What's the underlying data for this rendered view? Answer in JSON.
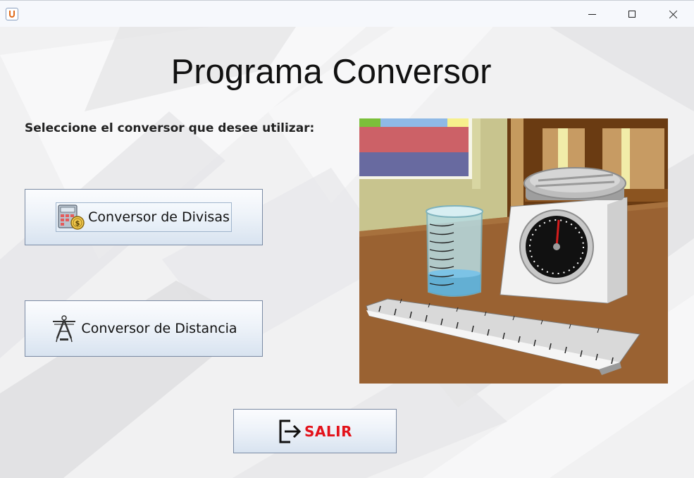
{
  "window": {
    "icon": "java-cup-icon",
    "controls": {
      "minimize_icon": "minimize-icon",
      "maximize_icon": "maximize-icon",
      "close_icon": "close-icon"
    }
  },
  "main": {
    "title": "Programa Conversor",
    "prompt": "Seleccione el conversor que desee utilizar:"
  },
  "buttons": {
    "divisas": {
      "label": "Conversor de Divisas",
      "icon": "calculator-coin-icon"
    },
    "distancia": {
      "label": "Conversor de Distancia",
      "icon": "compass-icon"
    },
    "salir": {
      "label": "SALIR",
      "icon": "exit-icon",
      "color": "#e3121a"
    }
  },
  "illustration": {
    "subject": "measurement-tools-scene"
  }
}
